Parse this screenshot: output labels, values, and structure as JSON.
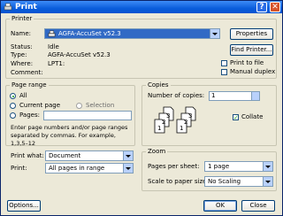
{
  "window": {
    "title": "Print",
    "help_glyph": "?",
    "close_glyph": "✕"
  },
  "printer": {
    "group_label": "Printer",
    "name_label": "Name:",
    "name_value": "AGFA-AccuSet v52.3",
    "status_label": "Status:",
    "status_value": "Idle",
    "type_label": "Type:",
    "type_value": "AGFA-AccuSet v52.3",
    "where_label": "Where:",
    "where_value": "LPT1:",
    "comment_label": "Comment:",
    "properties_button": "Properties",
    "find_printer_button": "Find Printer...",
    "print_to_file_label": "Print to file",
    "manual_duplex_label": "Manual duplex",
    "print_to_file_checked": false,
    "manual_duplex_checked": false
  },
  "page_range": {
    "group_label": "Page range",
    "all_label": "All",
    "current_page_label": "Current page",
    "selection_label": "Selection",
    "pages_label": "Pages:",
    "selected": "all",
    "hint": "Enter page numbers and/or page ranges separated by commas.  For example, 1,3,5–12"
  },
  "copies": {
    "group_label": "Copies",
    "number_label": "Number of copies:",
    "number_value": "1",
    "collate_label": "Collate",
    "collate_checked": true
  },
  "print_what": {
    "label": "Print what:",
    "value": "Document"
  },
  "print": {
    "label": "Print:",
    "value": "All pages in range"
  },
  "zoom": {
    "group_label": "Zoom",
    "pages_per_sheet_label": "Pages per sheet:",
    "pages_per_sheet_value": "1 page",
    "scale_label": "Scale to paper size:",
    "scale_value": "No Scaling"
  },
  "buttons": {
    "options": "Options...",
    "ok": "OK",
    "close": "Close"
  }
}
